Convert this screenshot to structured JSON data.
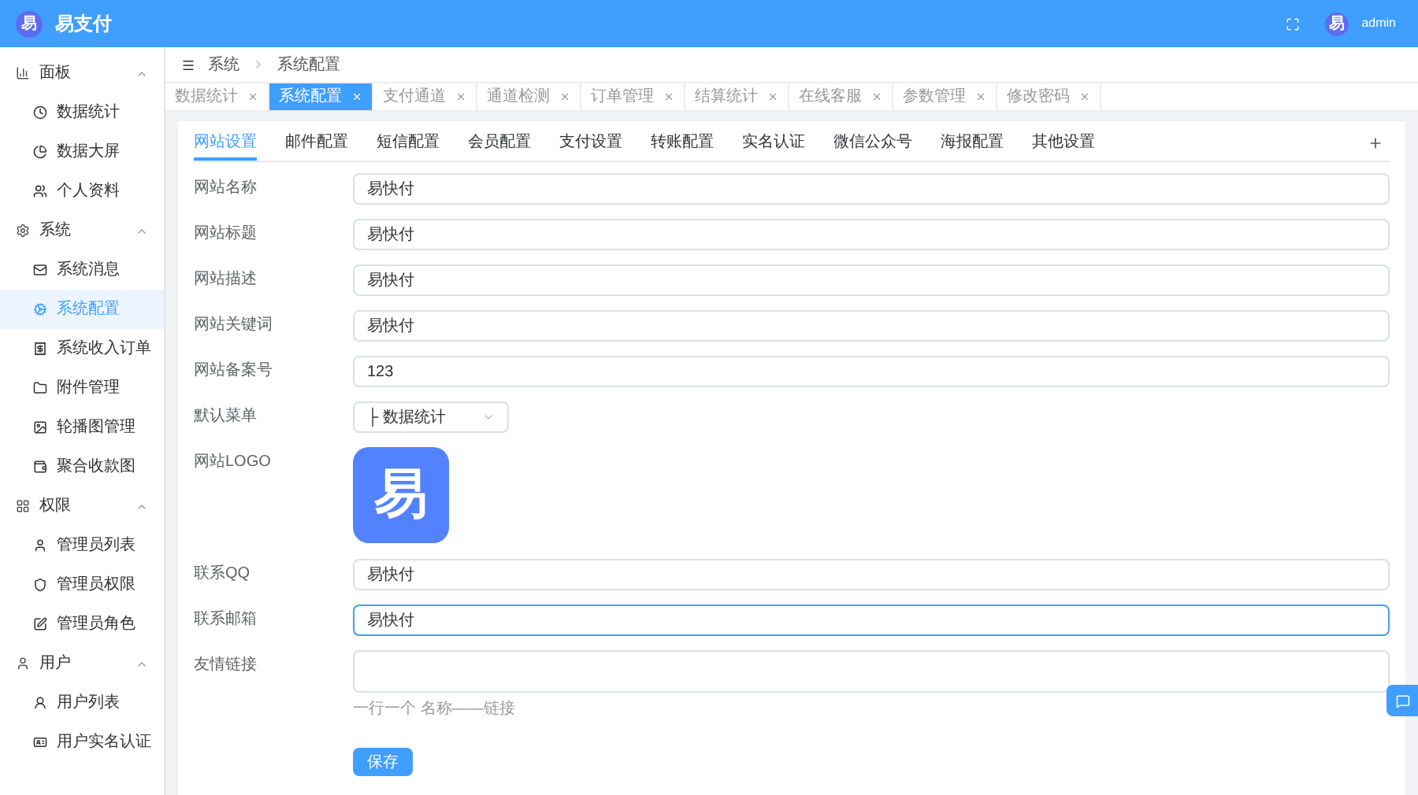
{
  "header": {
    "logo_glyph": "易",
    "title": "易支付",
    "avatar_glyph": "易",
    "username": "admin"
  },
  "sidebar": {
    "groups": [
      {
        "label": "面板",
        "expanded": true,
        "items": [
          {
            "label": "数据统计",
            "selected": false
          },
          {
            "label": "数据大屏",
            "selected": false
          },
          {
            "label": "个人资料",
            "selected": false
          }
        ]
      },
      {
        "label": "系统",
        "expanded": true,
        "items": [
          {
            "label": "系统消息",
            "selected": false
          },
          {
            "label": "系统配置",
            "selected": true
          },
          {
            "label": "系统收入订单",
            "selected": false
          },
          {
            "label": "附件管理",
            "selected": false
          },
          {
            "label": "轮播图管理",
            "selected": false
          },
          {
            "label": "聚合收款图",
            "selected": false
          }
        ]
      },
      {
        "label": "权限",
        "expanded": true,
        "items": [
          {
            "label": "管理员列表",
            "selected": false
          },
          {
            "label": "管理员权限",
            "selected": false
          },
          {
            "label": "管理员角色",
            "selected": false
          }
        ]
      },
      {
        "label": "用户",
        "expanded": true,
        "items": [
          {
            "label": "用户列表",
            "selected": false
          },
          {
            "label": "用户实名认证",
            "selected": false
          }
        ]
      }
    ]
  },
  "breadcrumb": [
    "系统",
    "系统配置"
  ],
  "page_tabs": [
    {
      "label": "数据统计",
      "selected": false
    },
    {
      "label": "系统配置",
      "selected": true
    },
    {
      "label": "支付通道",
      "selected": false
    },
    {
      "label": "通道检测",
      "selected": false
    },
    {
      "label": "订单管理",
      "selected": false
    },
    {
      "label": "结算统计",
      "selected": false
    },
    {
      "label": "在线客服",
      "selected": false
    },
    {
      "label": "参数管理",
      "selected": false
    },
    {
      "label": "修改密码",
      "selected": false
    }
  ],
  "config_tabs": [
    {
      "label": "网站设置",
      "selected": true
    },
    {
      "label": "邮件配置",
      "selected": false
    },
    {
      "label": "短信配置",
      "selected": false
    },
    {
      "label": "会员配置",
      "selected": false
    },
    {
      "label": "支付设置",
      "selected": false
    },
    {
      "label": "转账配置",
      "selected": false
    },
    {
      "label": "实名认证",
      "selected": false
    },
    {
      "label": "微信公众号",
      "selected": false
    },
    {
      "label": "海报配置",
      "selected": false
    },
    {
      "label": "其他设置",
      "selected": false
    }
  ],
  "fields": [
    {
      "kind": "text",
      "label": "网站名称",
      "value": "易快付",
      "focused": false
    },
    {
      "kind": "text",
      "label": "网站标题",
      "value": "易快付",
      "focused": false
    },
    {
      "kind": "text",
      "label": "网站描述",
      "value": "易快付",
      "focused": false
    },
    {
      "kind": "text",
      "label": "网站关键词",
      "value": "易快付",
      "focused": false
    },
    {
      "kind": "text",
      "label": "网站备案号",
      "value": "123",
      "focused": false
    },
    {
      "kind": "select",
      "label": "默认菜单",
      "value": "├ 数据统计"
    },
    {
      "kind": "image",
      "label": "网站LOGO",
      "glyph": "易"
    },
    {
      "kind": "text",
      "label": "联系QQ",
      "value": "易快付",
      "focused": false
    },
    {
      "kind": "text",
      "label": "联系邮箱",
      "value": "易快付",
      "focused": true
    },
    {
      "kind": "textarea",
      "label": "友情链接",
      "hint": "一行一个 名称——链接"
    }
  ],
  "save_button": "保存"
}
